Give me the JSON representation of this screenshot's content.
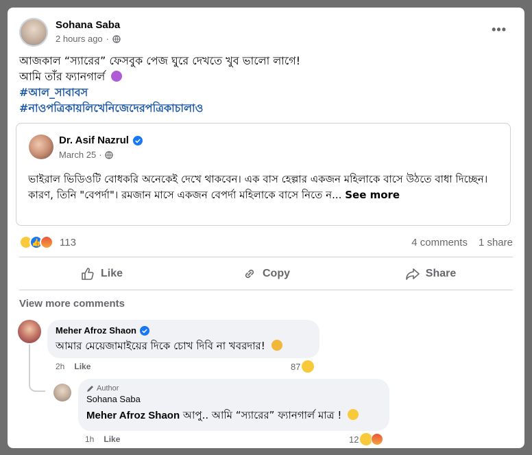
{
  "post": {
    "author": "Sohana Saba",
    "time": "2 hours ago",
    "line1": "আজকাল “স্যারের” ফেসবুক পেজ ঘুরে দেখতে খুব ভালো লাগে!",
    "line2": "আমি তাঁর ফ্যানগার্ল",
    "hashtag1": "#আল_সাবাবস",
    "hashtag2": "#নাওপত্রিকায়লিখেনিজেদেরপত্রিকাচালাও"
  },
  "shared": {
    "author": "Dr. Asif Nazrul",
    "time": "March 25",
    "text": "ভাইরাল ভিডিওটি বোধকরি অনেকেই দেখে থাকবেন। এক বাস হেল্পার একজন মহিলাকে বাসে উঠতে বাধা দিচ্ছেন। কারণ, তিনি \"বেপর্দা\"। রমজান মাসে একজন বেপর্দা মহিলাকে বাসে নিতে ন...",
    "see_more": "See more"
  },
  "stats": {
    "reaction_count": "113",
    "comments": "4 comments",
    "shares": "1 share"
  },
  "actions": {
    "like": "Like",
    "copy": "Copy",
    "share": "Share"
  },
  "view_more_comments": "View more comments",
  "comments": [
    {
      "author": "Meher Afroz Shaon",
      "text": "আমার মেয়েজামাইয়ের দিকে চোখ দিবি না খবরদার!",
      "time": "2h",
      "like": "Like",
      "reaction_count": "87"
    },
    {
      "author_tag": "Author",
      "author": "Sohana Saba",
      "mention": "Meher Afroz Shaon",
      "text": "আপু.. আমি “স্যারের” ফ্যানগার্ল মাত্র !",
      "time": "1h",
      "like": "Like",
      "reaction_count": "12"
    }
  ],
  "colors": {
    "facebook_blue": "#1877f2",
    "hashtag": "#1f5aa8",
    "secondary_text": "#65676b"
  }
}
